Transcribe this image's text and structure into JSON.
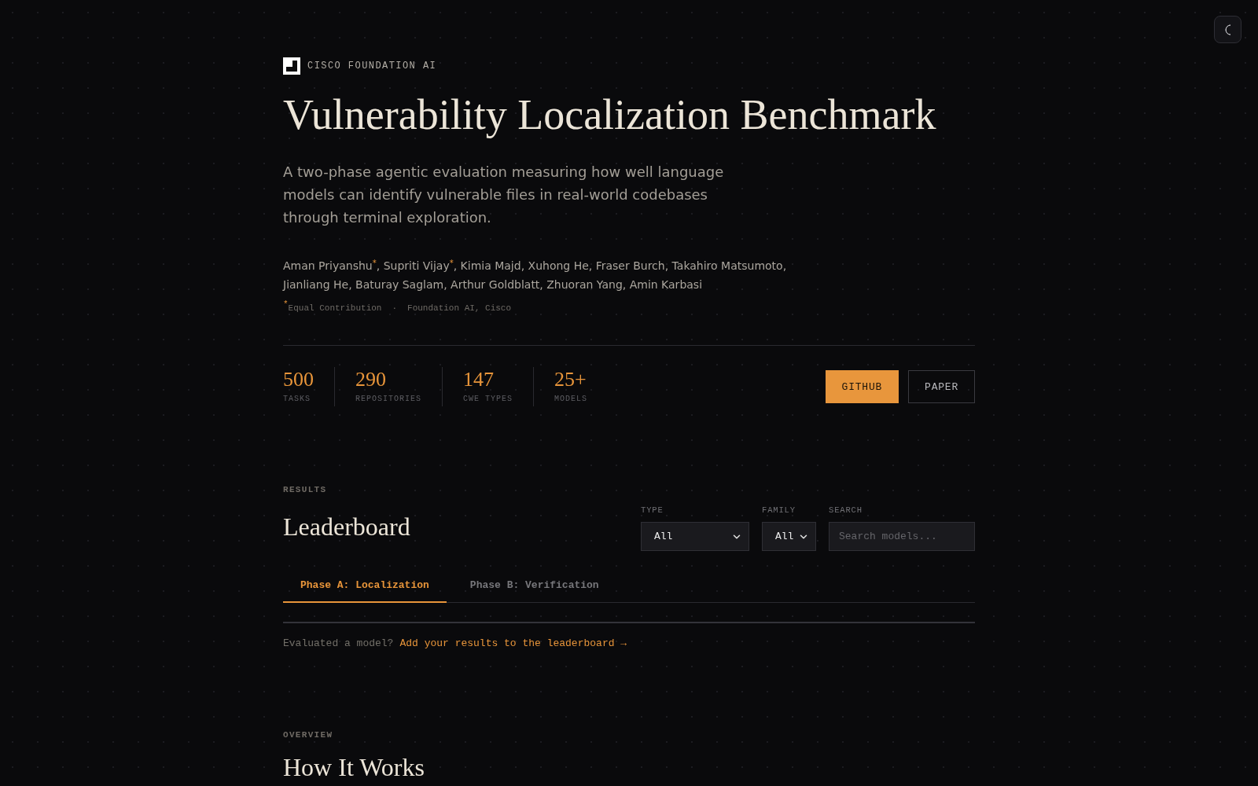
{
  "brand": {
    "name": "CISCO FOUNDATION AI"
  },
  "hero": {
    "title": "Vulnerability Localization Benchmark",
    "description": "A two-phase agentic evaluation measuring how well language models can identify vulnerable files in real-world codebases through terminal exploration.",
    "authors": "Aman Priyanshu$^{*}$, Supriti Vijay$^{*}$, Kimia Majd, Xuhong He, Fraser Burch, Takahiro Matsumoto, Jianliang He, Baturay Saglam, Arthur Goldblatt, Zhuoran Yang, Amin Karbasi",
    "footnote": {
      "note": "$^{*}$Equal Contribution",
      "separator": "·",
      "affiliation": "Foundation AI, Cisco"
    }
  },
  "stats": [
    {
      "value": "500",
      "label": "TASKS"
    },
    {
      "value": "290",
      "label": "REPOSITORIES"
    },
    {
      "value": "147",
      "label": "CWE TYPES"
    },
    {
      "value": "25+",
      "label": "MODELS"
    }
  ],
  "buttons": [
    {
      "label": "GITHUB",
      "kind": "primary"
    },
    {
      "label": "PAPER",
      "kind": "outline"
    }
  ],
  "leaderboard": {
    "eyebrow": "RESULTS",
    "title": "Leaderboard",
    "filters": [
      {
        "kind": "select",
        "label": "TYPE",
        "value": "All"
      },
      {
        "kind": "select",
        "label": "FAMILY",
        "value": "All"
      },
      {
        "kind": "search",
        "label": "SEARCH",
        "placeholder": "Search models..."
      }
    ],
    "tabs": [
      {
        "label": "Phase A: Localization",
        "selected": true
      },
      {
        "label": "Phase B: Verification",
        "selected": false
      }
    ],
    "cta": {
      "text": "Evaluated a model?",
      "link": "Add your results to the leaderboard →"
    }
  },
  "overview": {
    "eyebrow": "OVERVIEW",
    "title": "How It Works"
  }
}
